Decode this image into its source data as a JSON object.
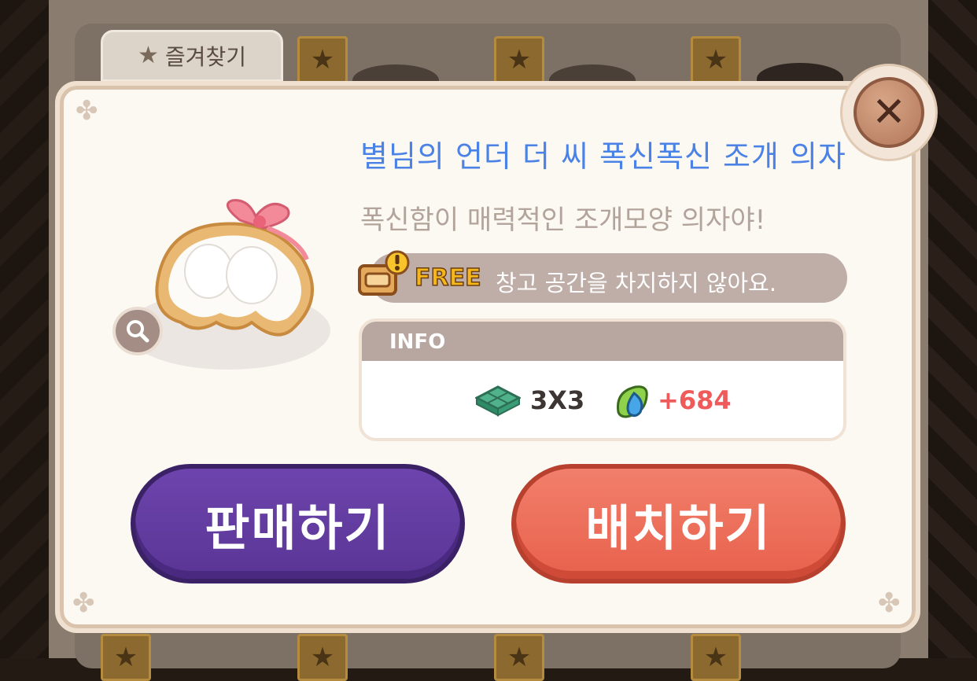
{
  "background": {
    "favorites_tab": {
      "label": "즐겨찾기",
      "icon": "star-icon"
    }
  },
  "item": {
    "name": "별님의 언더 더 씨 폭신폭신 조개 의자",
    "description": "폭신함이 매력적인 조개모양 의자야!",
    "image_icon": "shell-chair-image",
    "free_badge": {
      "label": "FREE",
      "text": "창고 공간을 차지하지 않아요.",
      "icon": "storage-box-icon"
    },
    "info": {
      "header": "INFO",
      "size": "3X3",
      "size_icon": "floor-tile-icon",
      "points": "+684",
      "points_icon": "leaf-drop-icon"
    }
  },
  "buttons": {
    "sell": "판매하기",
    "place": "배치하기",
    "close_icon": "close-icon",
    "zoom_icon": "magnifier-icon"
  },
  "colors": {
    "title": "#4b82e6",
    "points": "#ef5b5b",
    "sell_button": "#5f3a9c",
    "place_button": "#ec6a55",
    "free_label": "#f4b61a"
  }
}
